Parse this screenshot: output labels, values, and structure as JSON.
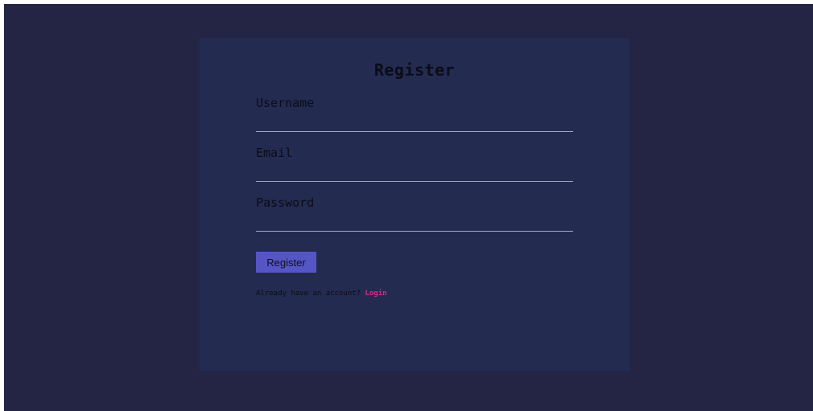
{
  "form": {
    "title": "Register",
    "fields": [
      {
        "label": "Username",
        "value": "",
        "placeholder": ""
      },
      {
        "label": "Email",
        "value": "",
        "placeholder": ""
      },
      {
        "label": "Password",
        "value": "",
        "placeholder": ""
      }
    ],
    "submit_label": "Register",
    "footer": {
      "prompt": "Already have an account?",
      "link_label": "Login"
    }
  },
  "colors": {
    "page_background": "#242545",
    "card_background": "#242b50",
    "button_background": "#5655c5",
    "link": "#d52a8c",
    "input_underline": "#a2a6c2"
  }
}
